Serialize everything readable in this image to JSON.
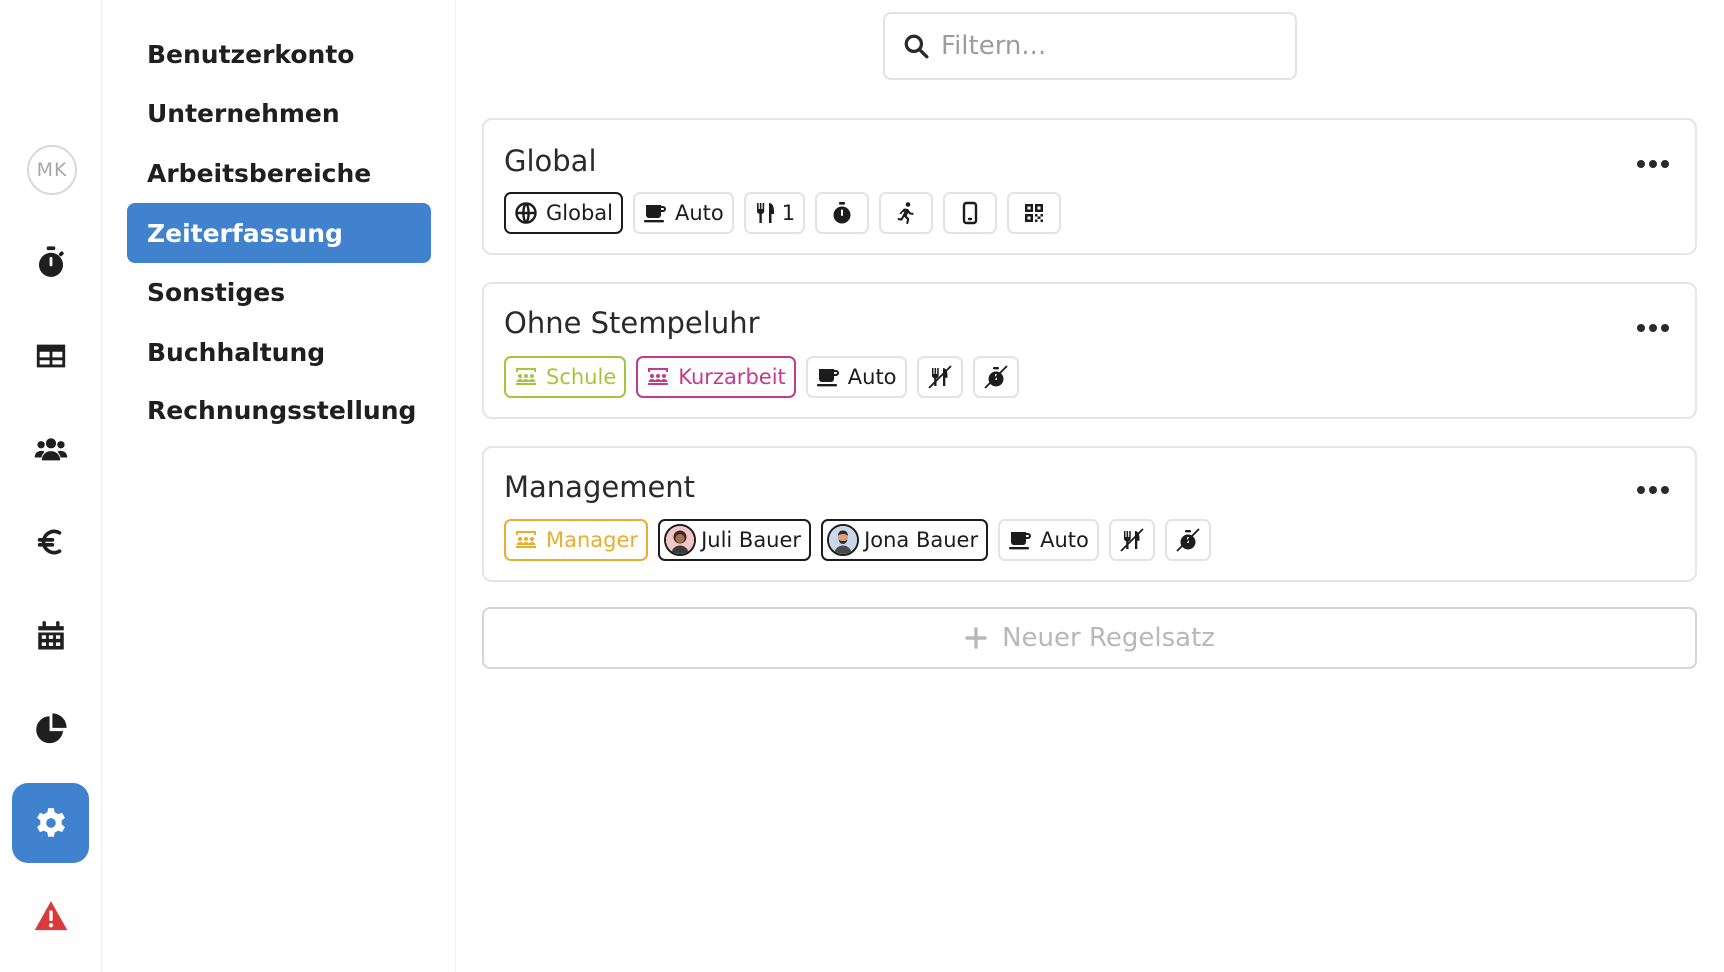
{
  "rail": {
    "avatar_initials": "MK",
    "items": [
      {
        "icon": "stopwatch-icon"
      },
      {
        "icon": "table-icon"
      },
      {
        "icon": "users-icon"
      },
      {
        "icon": "euro-icon"
      },
      {
        "icon": "calendar-icon"
      },
      {
        "icon": "pie-chart-icon"
      },
      {
        "icon": "gear-icon",
        "active": true
      },
      {
        "icon": "warning-icon"
      }
    ]
  },
  "subnav": {
    "items": [
      {
        "label": "Benutzerkonto"
      },
      {
        "label": "Unternehmen"
      },
      {
        "label": "Arbeitsbereiche"
      },
      {
        "label": "Zeiterfassung",
        "active": true
      },
      {
        "label": "Sonstiges"
      },
      {
        "label": "Buchhaltung"
      },
      {
        "label": "Rechnungsstellung"
      }
    ]
  },
  "search": {
    "placeholder": "Filtern..."
  },
  "rulesets": [
    {
      "title": "Global",
      "chips": [
        {
          "icon": "globe-icon",
          "label": "Global"
        },
        {
          "icon": "coffee-icon",
          "label": "Auto"
        },
        {
          "icon": "utensils-icon",
          "label": "1"
        },
        {
          "icon": "stopwatch-icon"
        },
        {
          "icon": "running-icon"
        },
        {
          "icon": "mobile-icon"
        },
        {
          "icon": "qrcode-icon"
        }
      ]
    },
    {
      "title": "Ohne Stempeluhr",
      "chips": [
        {
          "icon": "group-icon",
          "label": "Schule",
          "color": "#a7c43c"
        },
        {
          "icon": "group-icon",
          "label": "Kurzarbeit",
          "color": "#c23b8c"
        },
        {
          "icon": "coffee-icon",
          "label": "Auto"
        },
        {
          "icon": "utensils-slash-icon"
        },
        {
          "icon": "stopwatch-slash-icon"
        }
      ]
    },
    {
      "title": "Management",
      "chips": [
        {
          "icon": "group-icon",
          "label": "Manager",
          "color": "#e8ae2f"
        },
        {
          "icon": "avatar-female-icon",
          "label": "Juli Bauer"
        },
        {
          "icon": "avatar-male-icon",
          "label": "Jona Bauer"
        },
        {
          "icon": "coffee-icon",
          "label": "Auto"
        },
        {
          "icon": "utensils-slash-icon"
        },
        {
          "icon": "stopwatch-slash-icon"
        }
      ]
    }
  ],
  "new_ruleset": {
    "label": "Neuer Regelsatz"
  },
  "colors": {
    "accent": "#4182cf",
    "danger": "#d93a3a"
  }
}
